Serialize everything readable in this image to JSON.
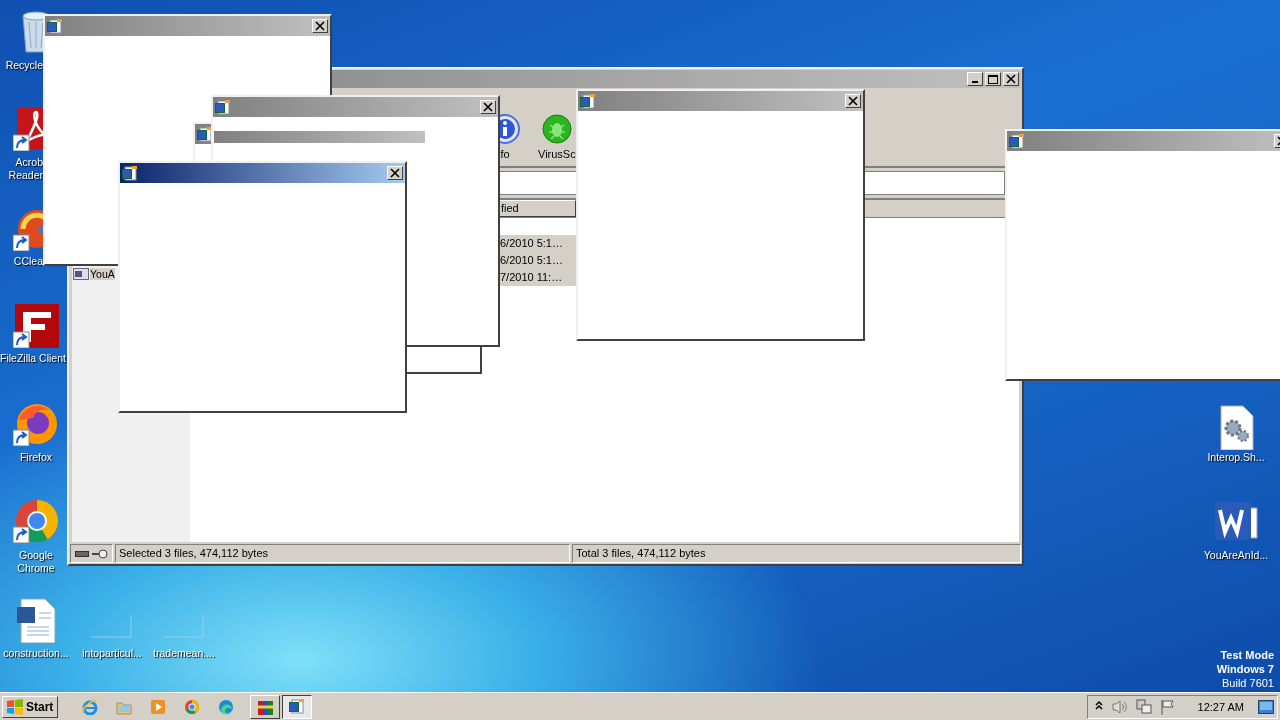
{
  "desktop": {
    "icons": [
      {
        "label": "Recycle",
        "kind": "bin",
        "shortcut": false
      },
      {
        "label": "Acrob\nReader",
        "kind": "pdf",
        "shortcut": true
      },
      {
        "label": "CClea",
        "kind": "brush",
        "shortcut": true
      },
      {
        "label": "FileZilla Client",
        "kind": "ftp",
        "shortcut": true
      },
      {
        "label": "Firefox",
        "kind": "fox",
        "shortcut": true
      },
      {
        "label": "Google\nChrome",
        "kind": "browser",
        "shortcut": true
      },
      {
        "label": "construction...",
        "kind": "document",
        "shortcut": false
      },
      {
        "label": "intoparticul...",
        "kind": "blank",
        "shortcut": false
      },
      {
        "label": "trademean....",
        "kind": "blank",
        "shortcut": false
      },
      {
        "label": "Interop.Sh...",
        "kind": "settings-file",
        "shortcut": false
      },
      {
        "label": "YouAreAnId...",
        "kind": "word",
        "shortcut": false
      }
    ],
    "system_notice": [
      "Test Mode",
      "Windows 7",
      "Build 7601"
    ]
  },
  "file_manager": {
    "active": false,
    "toolbar": [
      {
        "label": "fo",
        "kind": "info"
      },
      {
        "label": "VirusSc",
        "kind": "scan"
      }
    ],
    "column_header": "fied",
    "tree_item": {
      "label": "YouA",
      "selected": true
    },
    "rows": [
      {
        "modified": "6/2010 5:1…",
        "selected": true
      },
      {
        "modified": "6/2010 5:1…",
        "selected": true
      },
      {
        "modified": "7/2010 11:…",
        "selected": true
      }
    ],
    "status": [
      "Selected 3 files, 474,112 bytes",
      "Total 3 files, 474,112 bytes"
    ]
  },
  "popups": [
    {
      "active": false,
      "kind": "plain"
    },
    {
      "active": false,
      "kind": "plain"
    },
    {
      "active": false,
      "kind": "banner"
    },
    {
      "active": true,
      "kind": "plain"
    },
    {
      "active": false,
      "kind": "plain"
    },
    {
      "active": false,
      "kind": "plain"
    }
  ],
  "taskbar": {
    "start": "Start",
    "quick_launch": [
      {
        "kind": "ie"
      },
      {
        "kind": "folder"
      },
      {
        "kind": "media"
      },
      {
        "kind": "browser"
      },
      {
        "kind": "edge"
      }
    ],
    "tasks": [
      {
        "kind": "archive",
        "selected": false
      },
      {
        "kind": "word",
        "selected": true
      }
    ],
    "tray": [
      {
        "kind": "chevron"
      },
      {
        "kind": "speaker"
      },
      {
        "kind": "network"
      },
      {
        "kind": "flag"
      }
    ],
    "clock": "12:27 AM"
  }
}
